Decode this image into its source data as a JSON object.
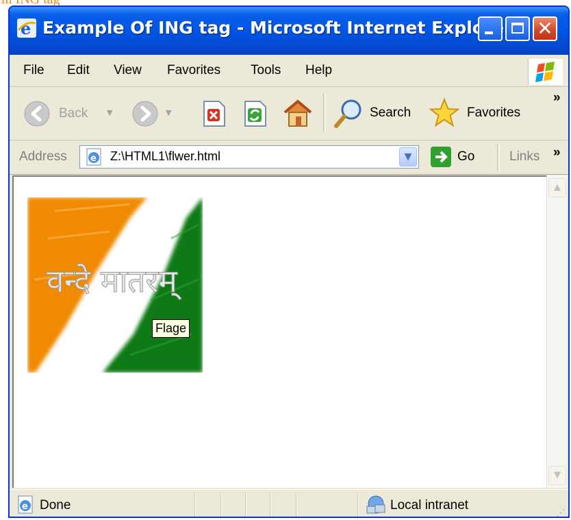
{
  "page_fragment": "m     ING tag",
  "window": {
    "title": "Example Of ING tag - Microsoft Internet Explorer"
  },
  "menu": {
    "items": [
      "File",
      "Edit",
      "View",
      "Favorites",
      "Tools",
      "Help"
    ]
  },
  "toolbar": {
    "back_label": "Back",
    "search_label": "Search",
    "favorites_label": "Favorites",
    "chevron": "»"
  },
  "address": {
    "label": "Address",
    "value": "Z:\\HTML1\\flwer.html",
    "go_label": "Go",
    "links_label": "Links",
    "chevron": "»"
  },
  "content": {
    "image_text": "वन्दे मातरम्",
    "tooltip": "Flage"
  },
  "status": {
    "left": "Done",
    "zone": "Local intranet"
  },
  "colors": {
    "saffron": "#f08a00",
    "green": "#0e7a12",
    "titlebar": "#0054e3"
  }
}
